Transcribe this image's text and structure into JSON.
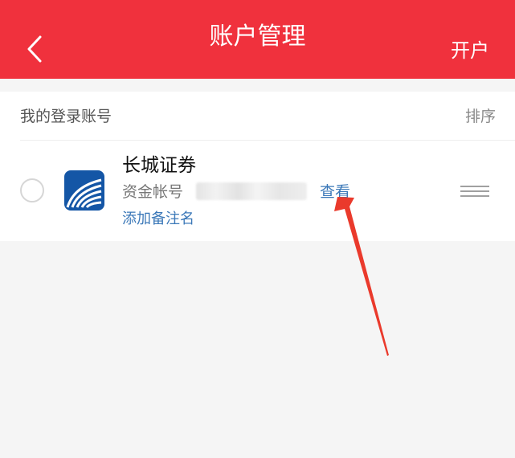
{
  "header": {
    "title": "账户管理",
    "right_action": "开户",
    "back_icon": "chevron-left-icon"
  },
  "section": {
    "title": "我的登录账号",
    "sort_label": "排序"
  },
  "account": {
    "broker_name": "长城证券",
    "account_label": "资金帐号",
    "view_label": "查看",
    "remark_label": "添加备注名",
    "logo_icon": "great-wall-securities-logo",
    "drag_icon": "drag-handle-icon"
  },
  "colors": {
    "header_bg": "#f0313d",
    "link": "#3b78b8",
    "logo_blue": "#1456a6",
    "arrow": "#ea3a2c"
  }
}
